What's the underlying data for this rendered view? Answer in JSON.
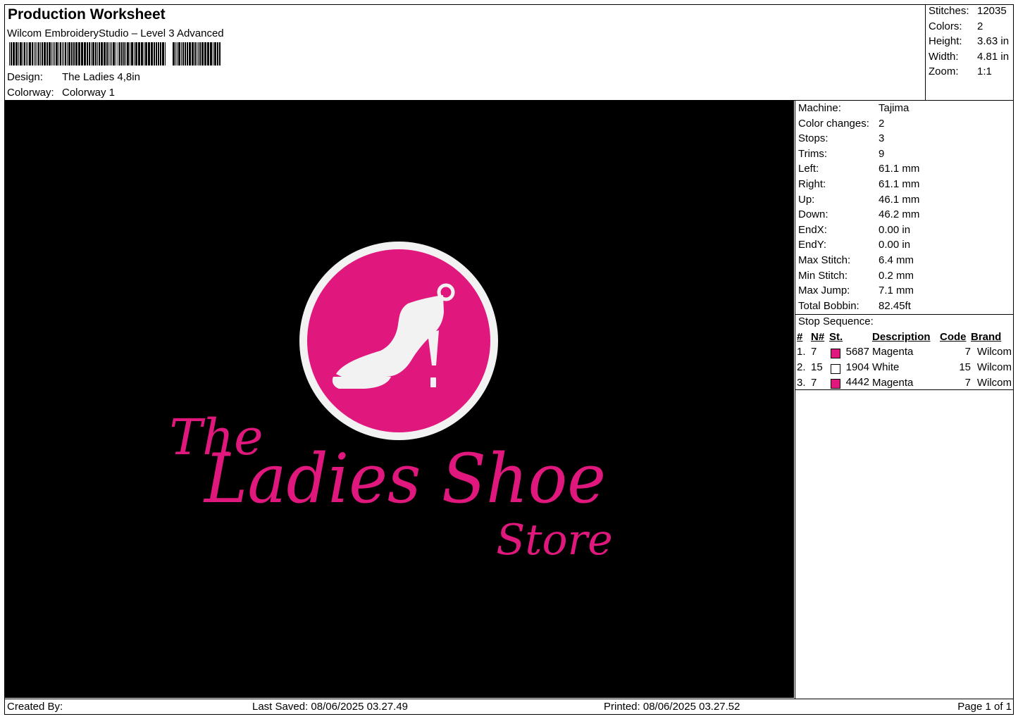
{
  "header": {
    "title": "Production Worksheet",
    "software": "Wilcom EmbroideryStudio – Level 3 Advanced",
    "design_label": "Design:",
    "design_value": "The Ladies 4,8in",
    "colorway_label": "Colorway:",
    "colorway_value": "Colorway 1"
  },
  "summary": [
    {
      "label": "Stitches:",
      "value": "12035"
    },
    {
      "label": "Colors:",
      "value": "2"
    },
    {
      "label": "Height:",
      "value": "3.63 in"
    },
    {
      "label": "Width:",
      "value": "4.81 in"
    },
    {
      "label": "Zoom:",
      "value": "1:1"
    }
  ],
  "machine_info": [
    {
      "label": "Machine:",
      "value": "Tajima"
    },
    {
      "label": "Color changes:",
      "value": "2"
    },
    {
      "label": "Stops:",
      "value": "3"
    },
    {
      "label": "Trims:",
      "value": "9"
    },
    {
      "label": "Left:",
      "value": "61.1 mm"
    },
    {
      "label": "Right:",
      "value": "61.1 mm"
    },
    {
      "label": "Up:",
      "value": "46.1 mm"
    },
    {
      "label": "Down:",
      "value": "46.2 mm"
    },
    {
      "label": "EndX:",
      "value": "0.00 in"
    },
    {
      "label": "EndY:",
      "value": "0.00 in"
    },
    {
      "label": "Max Stitch:",
      "value": "6.4 mm"
    },
    {
      "label": "Min Stitch:",
      "value": "0.2 mm"
    },
    {
      "label": "Max Jump:",
      "value": "7.1 mm"
    },
    {
      "label": "Total Bobbin:",
      "value": "82.45ft"
    }
  ],
  "stop_sequence": {
    "title": "Stop Sequence:",
    "columns": {
      "num": "#",
      "n": "N#",
      "st": "St.",
      "description": "Description",
      "code": "Code",
      "brand": "Brand"
    },
    "rows": [
      {
        "num": "1.",
        "n": "7",
        "swatch": "#e0187e",
        "st": "5687",
        "description": "Magenta",
        "code": "7",
        "brand": "Wilcom"
      },
      {
        "num": "2.",
        "n": "15",
        "swatch": "#ffffff",
        "st": "1904",
        "description": "White",
        "code": "15",
        "brand": "Wilcom"
      },
      {
        "num": "3.",
        "n": "7",
        "swatch": "#e0187e",
        "st": "4442",
        "description": "Magenta",
        "code": "7",
        "brand": "Wilcom"
      }
    ]
  },
  "design_preview": {
    "background": "#000000",
    "thread_primary": "#e0187e",
    "thread_secondary": "#f2f2f2",
    "icon": "high-heel-shoe-icon",
    "text_line1": "The",
    "text_line2": "Ladies Shoe",
    "text_line3": "Store"
  },
  "footer": {
    "created_by": "Created By:",
    "last_saved": "Last Saved: 08/06/2025 03.27.49",
    "printed": "Printed: 08/06/2025 03.27.52",
    "page": "Page 1 of 1"
  }
}
